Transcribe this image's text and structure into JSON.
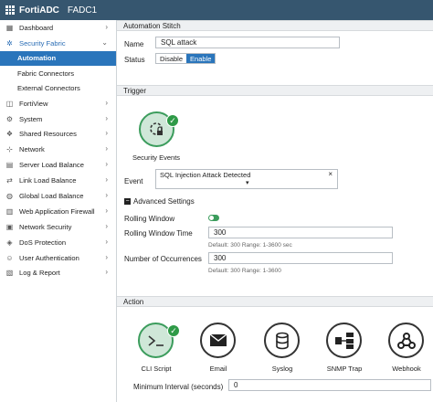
{
  "header": {
    "product": "FortiADC",
    "device": "FADC1"
  },
  "sidebar": {
    "items": [
      {
        "label": "Dashboard",
        "icon": "dashboard-icon"
      },
      {
        "label": "Security Fabric",
        "icon": "security-fabric-icon",
        "open": true,
        "children": [
          "Automation",
          "Fabric Connectors",
          "External Connectors"
        ],
        "active_child": "Automation"
      },
      {
        "label": "FortiView",
        "icon": "fortiview-icon"
      },
      {
        "label": "System",
        "icon": "gear-icon"
      },
      {
        "label": "Shared Resources",
        "icon": "shared-resources-icon"
      },
      {
        "label": "Network",
        "icon": "network-icon"
      },
      {
        "label": "Server Load Balance",
        "icon": "server-load-balance-icon"
      },
      {
        "label": "Link Load Balance",
        "icon": "link-load-balance-icon"
      },
      {
        "label": "Global Load Balance",
        "icon": "globe-icon"
      },
      {
        "label": "Web Application Firewall",
        "icon": "firewall-icon"
      },
      {
        "label": "Network Security",
        "icon": "lock-icon"
      },
      {
        "label": "DoS Protection",
        "icon": "shield-icon"
      },
      {
        "label": "User Authentication",
        "icon": "user-icon"
      },
      {
        "label": "Log & Report",
        "icon": "log-icon"
      }
    ]
  },
  "stitch": {
    "section_title": "Automation Stitch",
    "name_label": "Name",
    "name_value": "SQL attack",
    "status_label": "Status",
    "status_options": [
      "Disable",
      "Enable"
    ],
    "status_selected": "Enable"
  },
  "trigger": {
    "section_title": "Trigger",
    "tile_label": "Security Events",
    "event_label": "Event",
    "event_value": "SQL Injection Attack Detected",
    "advanced_label": "Advanced Settings",
    "rolling_window_label": "Rolling Window",
    "rolling_window_enabled": true,
    "rolling_window_time_label": "Rolling Window Time",
    "rolling_window_time_value": "300",
    "rolling_window_time_hint": "Default: 300 Range: 1-3600 sec",
    "occurrences_label": "Number of Occurrences",
    "occurrences_value": "300",
    "occurrences_hint": "Default: 300 Range: 1-3600"
  },
  "action": {
    "section_title": "Action",
    "tiles": [
      {
        "label": "CLI Script",
        "icon": "cli-script-icon",
        "selected": true
      },
      {
        "label": "Email",
        "icon": "email-icon",
        "selected": false
      },
      {
        "label": "Syslog",
        "icon": "syslog-icon",
        "selected": false
      },
      {
        "label": "SNMP Trap",
        "icon": "snmp-trap-icon",
        "selected": false
      },
      {
        "label": "Webhook",
        "icon": "webhook-icon",
        "selected": false
      }
    ],
    "min_interval_label": "Minimum Interval (seconds)",
    "min_interval_value": "0"
  },
  "colors": {
    "header": "#36566f",
    "active": "#2a75bb",
    "success": "#2e9a47"
  }
}
